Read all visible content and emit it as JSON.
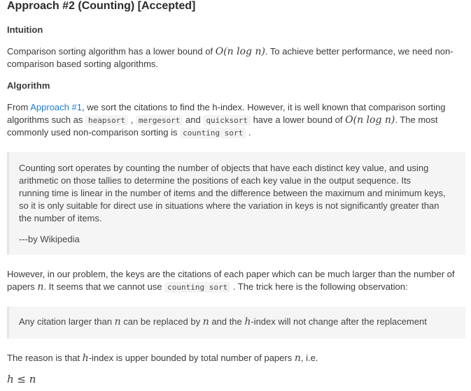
{
  "title": "Approach #2 (Counting) [Accepted]",
  "intuition": {
    "heading": "Intuition",
    "line1_pre": "Comparison sorting algorithm has a lower bound of ",
    "line1_math": "O(n log n)",
    "line1_post": ". To achieve better performance, we need non-",
    "line2": "comparison based sorting algorithms."
  },
  "algorithm": {
    "heading": "Algorithm",
    "line1_pre": "From ",
    "line1_link": "Approach #1",
    "line1_post": ", we sort the citations to find the h-index. However, it is well known that comparison sorting",
    "line2_pre": "algorithms such as ",
    "code_heapsort": "heapsort",
    "sep1": " , ",
    "code_mergesort": "mergesort",
    "and": " and ",
    "code_quicksort": "quicksort",
    "line2_mid": " have a lower bound of ",
    "line2_math": "O(n log n)",
    "line2_post": ". The most",
    "line3_pre": "commonly used non-comparison sorting is ",
    "code_counting_sort": "counting sort",
    "line3_post": " ."
  },
  "wiki_quote": {
    "lines": [
      "Counting sort operates by counting the number of objects that have each distinct key value, and using",
      "arithmetic on those tallies to determine the positions of each key value in the output sequence. Its",
      "running time is linear in the number of items and the difference between the maximum and minimum keys,",
      "so it is only suitable for direct use in situations where the variation in keys is not significantly greater than",
      "the number of items."
    ],
    "attribution": "---by Wikipedia"
  },
  "problem": {
    "line1": "However, in our problem, the keys are the citations of each paper which can be much larger than the number of",
    "line2_pre": "papers ",
    "line2_math": "n",
    "line2_mid": ". It seems that we cannot use ",
    "code_counting_sort": "counting sort",
    "line2_post": " . The trick here is the following observation:"
  },
  "observation": {
    "pre": "Any citation larger than ",
    "math_n1": "n",
    "mid1": " can be replaced by ",
    "math_n2": "n",
    "mid2": " and the ",
    "math_h": "h",
    "post": "-index will not change after the replacement"
  },
  "reason": {
    "pre": "The reason is that ",
    "math_h": "h",
    "mid": "-index is upper bounded by total number of papers ",
    "math_n": "n",
    "post": ", i.e."
  },
  "inequality": "h ≤ n"
}
